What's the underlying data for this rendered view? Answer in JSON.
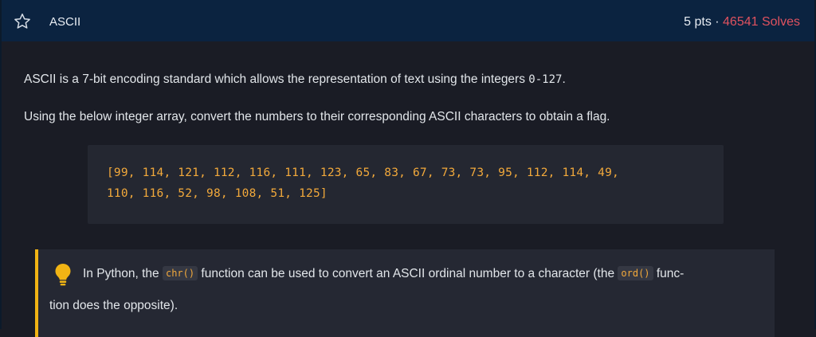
{
  "header": {
    "title": "ASCII",
    "points": "5 pts",
    "separator": " · ",
    "solves": "46541 Solves",
    "colors": {
      "background": "#0b2340",
      "solves": "#e0525f"
    },
    "star_icon": "star-outline-icon"
  },
  "description": {
    "p1_text": "ASCII is a 7-bit encoding standard which allows the representation of text using the integers ",
    "p1_code": "0-127",
    "p1_end": ".",
    "p2_text": "Using the below integer array, convert the numbers to their corresponding ASCII characters to obtain a flag."
  },
  "code": {
    "line1": "[99, 114, 121, 112, 116, 111, 123, 65, 83, 67, 73, 73, 95, 112, 114, 49,",
    "line2": "110, 116, 52, 98, 108, 51, 125]",
    "color": "#f2a93b"
  },
  "hint": {
    "icon": "lightbulb-icon",
    "part1": "In Python, the ",
    "code1": "chr()",
    "part2": " function can be used to convert an ASCII ordinal number to a character (the ",
    "code2": "ord()",
    "part3": " func-",
    "line2": "tion does the opposite).",
    "accent": "#f1b414"
  }
}
